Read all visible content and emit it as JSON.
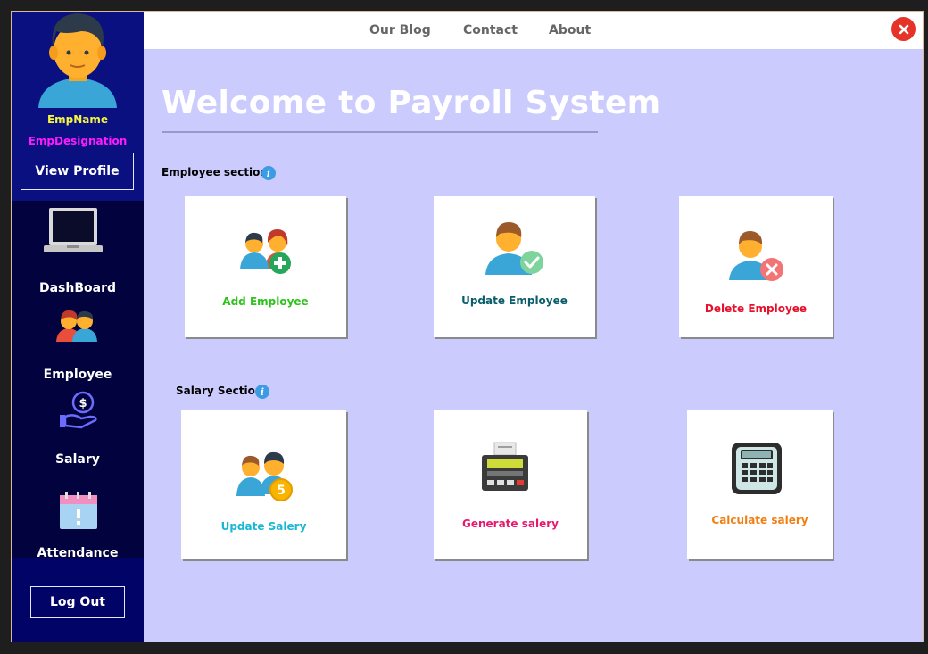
{
  "sidebar": {
    "emp_name": "EmpName",
    "emp_designation": "EmpDesignation",
    "view_profile": "View Profile",
    "nav": [
      {
        "label": "DashBoard",
        "icon": "laptop-icon"
      },
      {
        "label": "Employee",
        "icon": "employees-icon"
      },
      {
        "label": "Salary",
        "icon": "salary-hand-icon"
      },
      {
        "label": "Attendance",
        "icon": "calendar-icon"
      }
    ],
    "logout": "Log Out"
  },
  "topbar": {
    "links": [
      "Our Blog",
      "Contact",
      "About"
    ]
  },
  "main": {
    "title": "Welcome to Payroll System",
    "employee_section": {
      "label": "Employee section",
      "cards": [
        {
          "label": "Add Employee",
          "color": "#2ec21c"
        },
        {
          "label": "Update Employee",
          "color": "#0a5e6b"
        },
        {
          "label": "Delete Employee",
          "color": "#e8102a"
        }
      ]
    },
    "salary_section": {
      "label": "Salary Section",
      "cards": [
        {
          "label": "Update Salery",
          "color": "#16b8d4"
        },
        {
          "label": "Generate salery",
          "color": "#e8186e"
        },
        {
          "label": "Calculate salery",
          "color": "#f07f13"
        }
      ]
    }
  },
  "colors": {
    "sidebar": "#010466",
    "content_bg": "#cccbfe",
    "close": "#e5332a"
  }
}
